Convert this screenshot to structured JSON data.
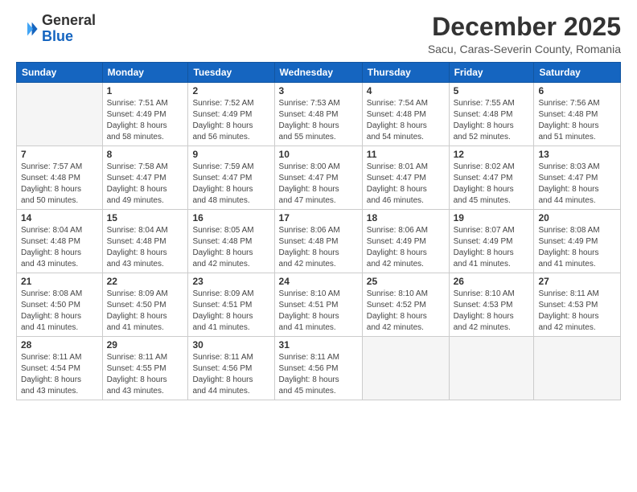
{
  "logo": {
    "line1": "General",
    "line2": "Blue"
  },
  "title": "December 2025",
  "subtitle": "Sacu, Caras-Severin County, Romania",
  "days_header": [
    "Sunday",
    "Monday",
    "Tuesday",
    "Wednesday",
    "Thursday",
    "Friday",
    "Saturday"
  ],
  "weeks": [
    [
      {
        "num": "",
        "info": ""
      },
      {
        "num": "1",
        "info": "Sunrise: 7:51 AM\nSunset: 4:49 PM\nDaylight: 8 hours\nand 58 minutes."
      },
      {
        "num": "2",
        "info": "Sunrise: 7:52 AM\nSunset: 4:49 PM\nDaylight: 8 hours\nand 56 minutes."
      },
      {
        "num": "3",
        "info": "Sunrise: 7:53 AM\nSunset: 4:48 PM\nDaylight: 8 hours\nand 55 minutes."
      },
      {
        "num": "4",
        "info": "Sunrise: 7:54 AM\nSunset: 4:48 PM\nDaylight: 8 hours\nand 54 minutes."
      },
      {
        "num": "5",
        "info": "Sunrise: 7:55 AM\nSunset: 4:48 PM\nDaylight: 8 hours\nand 52 minutes."
      },
      {
        "num": "6",
        "info": "Sunrise: 7:56 AM\nSunset: 4:48 PM\nDaylight: 8 hours\nand 51 minutes."
      }
    ],
    [
      {
        "num": "7",
        "info": "Sunrise: 7:57 AM\nSunset: 4:48 PM\nDaylight: 8 hours\nand 50 minutes."
      },
      {
        "num": "8",
        "info": "Sunrise: 7:58 AM\nSunset: 4:47 PM\nDaylight: 8 hours\nand 49 minutes."
      },
      {
        "num": "9",
        "info": "Sunrise: 7:59 AM\nSunset: 4:47 PM\nDaylight: 8 hours\nand 48 minutes."
      },
      {
        "num": "10",
        "info": "Sunrise: 8:00 AM\nSunset: 4:47 PM\nDaylight: 8 hours\nand 47 minutes."
      },
      {
        "num": "11",
        "info": "Sunrise: 8:01 AM\nSunset: 4:47 PM\nDaylight: 8 hours\nand 46 minutes."
      },
      {
        "num": "12",
        "info": "Sunrise: 8:02 AM\nSunset: 4:47 PM\nDaylight: 8 hours\nand 45 minutes."
      },
      {
        "num": "13",
        "info": "Sunrise: 8:03 AM\nSunset: 4:47 PM\nDaylight: 8 hours\nand 44 minutes."
      }
    ],
    [
      {
        "num": "14",
        "info": "Sunrise: 8:04 AM\nSunset: 4:48 PM\nDaylight: 8 hours\nand 43 minutes."
      },
      {
        "num": "15",
        "info": "Sunrise: 8:04 AM\nSunset: 4:48 PM\nDaylight: 8 hours\nand 43 minutes."
      },
      {
        "num": "16",
        "info": "Sunrise: 8:05 AM\nSunset: 4:48 PM\nDaylight: 8 hours\nand 42 minutes."
      },
      {
        "num": "17",
        "info": "Sunrise: 8:06 AM\nSunset: 4:48 PM\nDaylight: 8 hours\nand 42 minutes."
      },
      {
        "num": "18",
        "info": "Sunrise: 8:06 AM\nSunset: 4:49 PM\nDaylight: 8 hours\nand 42 minutes."
      },
      {
        "num": "19",
        "info": "Sunrise: 8:07 AM\nSunset: 4:49 PM\nDaylight: 8 hours\nand 41 minutes."
      },
      {
        "num": "20",
        "info": "Sunrise: 8:08 AM\nSunset: 4:49 PM\nDaylight: 8 hours\nand 41 minutes."
      }
    ],
    [
      {
        "num": "21",
        "info": "Sunrise: 8:08 AM\nSunset: 4:50 PM\nDaylight: 8 hours\nand 41 minutes."
      },
      {
        "num": "22",
        "info": "Sunrise: 8:09 AM\nSunset: 4:50 PM\nDaylight: 8 hours\nand 41 minutes."
      },
      {
        "num": "23",
        "info": "Sunrise: 8:09 AM\nSunset: 4:51 PM\nDaylight: 8 hours\nand 41 minutes."
      },
      {
        "num": "24",
        "info": "Sunrise: 8:10 AM\nSunset: 4:51 PM\nDaylight: 8 hours\nand 41 minutes."
      },
      {
        "num": "25",
        "info": "Sunrise: 8:10 AM\nSunset: 4:52 PM\nDaylight: 8 hours\nand 42 minutes."
      },
      {
        "num": "26",
        "info": "Sunrise: 8:10 AM\nSunset: 4:53 PM\nDaylight: 8 hours\nand 42 minutes."
      },
      {
        "num": "27",
        "info": "Sunrise: 8:11 AM\nSunset: 4:53 PM\nDaylight: 8 hours\nand 42 minutes."
      }
    ],
    [
      {
        "num": "28",
        "info": "Sunrise: 8:11 AM\nSunset: 4:54 PM\nDaylight: 8 hours\nand 43 minutes."
      },
      {
        "num": "29",
        "info": "Sunrise: 8:11 AM\nSunset: 4:55 PM\nDaylight: 8 hours\nand 43 minutes."
      },
      {
        "num": "30",
        "info": "Sunrise: 8:11 AM\nSunset: 4:56 PM\nDaylight: 8 hours\nand 44 minutes."
      },
      {
        "num": "31",
        "info": "Sunrise: 8:11 AM\nSunset: 4:56 PM\nDaylight: 8 hours\nand 45 minutes."
      },
      {
        "num": "",
        "info": ""
      },
      {
        "num": "",
        "info": ""
      },
      {
        "num": "",
        "info": ""
      }
    ]
  ]
}
